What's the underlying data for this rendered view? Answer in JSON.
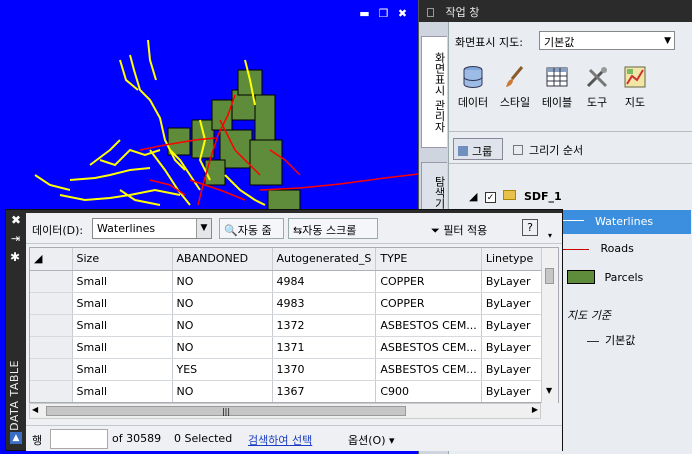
{
  "window_controls": {
    "minimize": "▬",
    "restore": "❐",
    "close": "✖"
  },
  "palette": {
    "title": "작업 창",
    "vertical_tabs": [
      "화면표시 관리자",
      "탐색기"
    ],
    "display_map_label": "화면표시 지도:",
    "display_map_value": "기본값",
    "tools": [
      {
        "icon": "database-icon",
        "label": "데이터"
      },
      {
        "icon": "brush-icon",
        "label": "스타일"
      },
      {
        "icon": "table-icon",
        "label": "테이블"
      },
      {
        "icon": "tools-icon",
        "label": "도구"
      },
      {
        "icon": "map-icon",
        "label": "지도"
      }
    ],
    "group_label": "그룹",
    "draw_order_label": "그리기 순서",
    "tree": {
      "root": "SDF_1",
      "layers": [
        {
          "name": "Waterlines",
          "color": "#ffff00",
          "selected": true
        },
        {
          "name": "Roads",
          "color": "#ff0000",
          "selected": false
        },
        {
          "name": "Parcels",
          "color": "#5e8c3a",
          "selected": false
        }
      ],
      "map_base": "지도 기준",
      "default_item": "기본값"
    }
  },
  "data_table": {
    "side_title": "DATA TABLE",
    "data_label": "데이터(D):",
    "data_source": "Waterlines",
    "zoom_label": "자동 줌",
    "scroll_label": "자동 스크롤",
    "filter_label": "필터 적용",
    "help_label": "?",
    "columns": [
      "Size",
      "ABANDONED",
      "Autogenerated_S",
      "TYPE",
      "Linetype"
    ],
    "rows": [
      [
        "Small",
        "NO",
        "4984",
        "COPPER",
        "ByLayer"
      ],
      [
        "Small",
        "NO",
        "4983",
        "COPPER",
        "ByLayer"
      ],
      [
        "Small",
        "NO",
        "1372",
        "ASBESTOS CEM...",
        "ByLayer"
      ],
      [
        "Small",
        "NO",
        "1371",
        "ASBESTOS CEM...",
        "ByLayer"
      ],
      [
        "Small",
        "YES",
        "1370",
        "ASBESTOS CEM...",
        "ByLayer"
      ],
      [
        "Small",
        "NO",
        "1367",
        "C900",
        "ByLayer"
      ]
    ],
    "status": {
      "row_label": "행",
      "of_count": "of 30589",
      "selected": "0 Selected",
      "select_by_search": "검색하여 선택",
      "options": "옵션(O) ▾"
    }
  }
}
